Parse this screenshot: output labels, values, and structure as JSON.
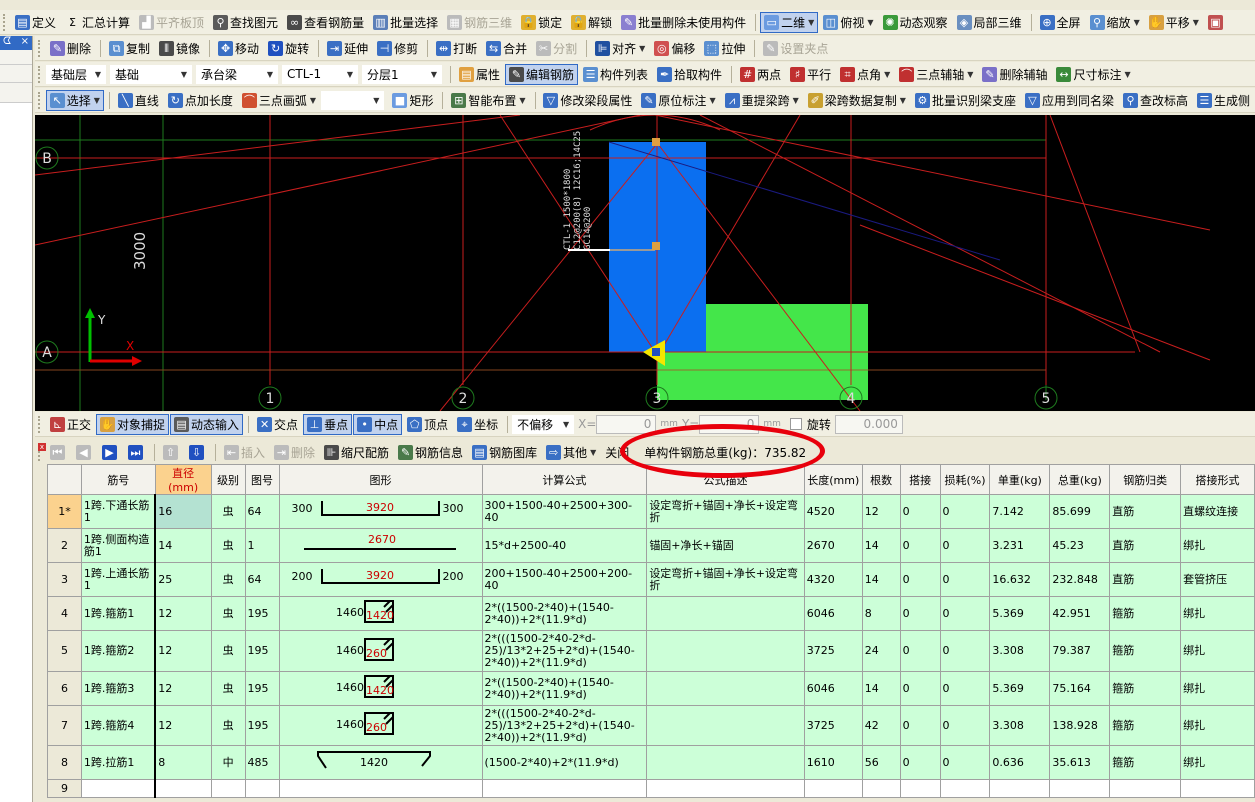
{
  "toolbar1": [
    {
      "icon": "define-icon",
      "glyph": "▤",
      "color": "#3a6fc4",
      "label": "定义"
    },
    {
      "icon": "sigma-icon",
      "glyph": "Σ",
      "color": "#f1efe2",
      "label": "汇总计算"
    },
    {
      "icon": "align-top-icon",
      "glyph": "▟",
      "color": "#bbb",
      "label": "平齐板顶",
      "disabled": true
    },
    {
      "icon": "binoculars-icon",
      "glyph": "⚲",
      "color": "#5a5a5a",
      "label": "查找图元"
    },
    {
      "icon": "view-rebar-icon",
      "glyph": "∞",
      "color": "#4a4a4a",
      "label": "查看钢筋量"
    },
    {
      "icon": "batch-select-icon",
      "glyph": "▥",
      "color": "#5b7fb8",
      "label": "批量选择"
    },
    {
      "icon": "rebar-3d-icon",
      "glyph": "▦",
      "color": "#bbb",
      "label": "钢筋三维",
      "disabled": true
    },
    {
      "icon": "lock-icon",
      "glyph": "🔒",
      "color": "#e0b030",
      "label": "锁定"
    },
    {
      "icon": "unlock-icon",
      "glyph": "🔓",
      "color": "#e0b030",
      "label": "解锁"
    },
    {
      "icon": "batch-delete-icon",
      "glyph": "✎",
      "color": "#8a7fd0",
      "label": "批量删除未使用构件"
    },
    {
      "sep": true
    },
    {
      "icon": "2d-icon",
      "glyph": "▭",
      "color": "#6b9be0",
      "label": "二维",
      "dropdown": true,
      "active": true
    },
    {
      "icon": "top-view-icon",
      "glyph": "◫",
      "color": "#5a8fd0",
      "label": "俯视",
      "dropdown": true
    },
    {
      "icon": "orbit-icon",
      "glyph": "✺",
      "color": "#3a9a3a",
      "label": "动态观察"
    },
    {
      "icon": "local-3d-icon",
      "glyph": "◈",
      "color": "#6a8fc0",
      "label": "局部三维"
    },
    {
      "sep": true
    },
    {
      "icon": "fullscreen-icon",
      "glyph": "⊕",
      "color": "#3a6fc4",
      "label": "全屏"
    },
    {
      "icon": "zoom-icon",
      "glyph": "⚲",
      "color": "#5a8fd0",
      "label": "缩放",
      "dropdown": true
    },
    {
      "icon": "pan-icon",
      "glyph": "✋",
      "color": "#d8a040",
      "label": "平移",
      "dropdown": true
    },
    {
      "icon": "screen-icon",
      "glyph": "▣",
      "color": "#c05050",
      "label": ""
    }
  ],
  "toolbar2": [
    {
      "icon": "eraser-icon",
      "glyph": "✎",
      "color": "#7a70c8",
      "label": "删除"
    },
    {
      "sep": true
    },
    {
      "icon": "copy-icon",
      "glyph": "⧉",
      "color": "#5a8fd0",
      "label": "复制"
    },
    {
      "icon": "mirror-icon",
      "glyph": "⫴",
      "color": "#4a4a4a",
      "label": "镜像"
    },
    {
      "sep": true
    },
    {
      "icon": "move-icon",
      "glyph": "✥",
      "color": "#3a6fc4",
      "label": "移动"
    },
    {
      "icon": "rotate-icon",
      "glyph": "↻",
      "color": "#2050c0",
      "label": "旋转"
    },
    {
      "sep": true
    },
    {
      "icon": "extend-icon",
      "glyph": "⇥",
      "color": "#3a6fc4",
      "label": "延伸"
    },
    {
      "icon": "trim-icon",
      "glyph": "⊣",
      "color": "#3a6fc4",
      "label": "修剪"
    },
    {
      "sep": true
    },
    {
      "icon": "break-icon",
      "glyph": "⇹",
      "color": "#3a6fc4",
      "label": "打断"
    },
    {
      "icon": "merge-icon",
      "glyph": "⇆",
      "color": "#3a6fc4",
      "label": "合并"
    },
    {
      "icon": "split-icon",
      "glyph": "✂",
      "color": "#bbb",
      "label": "分割",
      "disabled": true
    },
    {
      "sep": true
    },
    {
      "icon": "align-icon",
      "glyph": "⊫",
      "color": "#2050a0",
      "label": "对齐",
      "dropdown": true
    },
    {
      "icon": "offset-icon",
      "glyph": "◎",
      "color": "#d05050",
      "label": "偏移"
    },
    {
      "icon": "stretch-icon",
      "glyph": "⬚",
      "color": "#5a8fd0",
      "label": "拉伸"
    },
    {
      "sep": true
    },
    {
      "icon": "grip-point-icon",
      "glyph": "✎",
      "color": "#bbb",
      "label": "设置夹点",
      "disabled": true
    }
  ],
  "toolbar3_selects": [
    "基础层",
    "基础",
    "承台梁",
    "CTL-1",
    "分层1"
  ],
  "toolbar3": [
    {
      "icon": "properties-icon",
      "glyph": "▤",
      "color": "#e0a040",
      "label": "属性"
    },
    {
      "icon": "edit-rebar-icon",
      "glyph": "✎",
      "color": "#4a4a4a",
      "label": "编辑钢筋",
      "active": true
    },
    {
      "icon": "component-list-icon",
      "glyph": "☰",
      "color": "#5a8fd0",
      "label": "构件列表"
    },
    {
      "icon": "pick-component-icon",
      "glyph": "✒",
      "color": "#3a6fc4",
      "label": "拾取构件"
    },
    {
      "sep": true
    },
    {
      "icon": "two-point-icon",
      "glyph": "#",
      "color": "#c03030",
      "label": "两点"
    },
    {
      "icon": "parallel-icon",
      "glyph": "♯",
      "color": "#c03030",
      "label": "平行"
    },
    {
      "icon": "point-angle-icon",
      "glyph": "⌗",
      "color": "#c03030",
      "label": "点角",
      "dropdown": true
    },
    {
      "icon": "three-point-axis-icon",
      "glyph": "⌒",
      "color": "#c03030",
      "label": "三点辅轴",
      "dropdown": true
    },
    {
      "icon": "delete-axis-icon",
      "glyph": "✎",
      "color": "#7a70c8",
      "label": "删除辅轴"
    },
    {
      "icon": "dimension-icon",
      "glyph": "↔",
      "color": "#3a8a3a",
      "label": "尺寸标注",
      "dropdown": true
    }
  ],
  "toolbar4": [
    {
      "icon": "select-cursor-icon",
      "glyph": "↖",
      "color": "#5a8fd0",
      "label": "选择",
      "dropdown": true,
      "active": true
    },
    {
      "sep": true
    },
    {
      "icon": "line-icon",
      "glyph": "╲",
      "color": "#3a6fc4",
      "label": "直线"
    },
    {
      "icon": "point-length-icon",
      "glyph": "↻",
      "color": "#3a6fc4",
      "label": "点加长度"
    },
    {
      "icon": "arc-icon",
      "glyph": "⌒",
      "color": "#d05030",
      "label": "三点画弧",
      "dropdown": true
    },
    {
      "select": ""
    },
    {
      "icon": "rectangle-icon",
      "glyph": "■",
      "color": "#6b9be0",
      "label": "矩形"
    },
    {
      "sep": true
    },
    {
      "icon": "smart-layout-icon",
      "glyph": "⊞",
      "color": "#4a7a4a",
      "label": "智能布置",
      "dropdown": true
    },
    {
      "sep": true
    },
    {
      "icon": "modify-span-icon",
      "glyph": "▽",
      "color": "#3a6fc4",
      "label": "修改梁段属性"
    },
    {
      "icon": "in-situ-annotation-icon",
      "glyph": "✎",
      "color": "#3a6fc4",
      "label": "原位标注",
      "dropdown": true
    },
    {
      "icon": "re-extract-span-icon",
      "glyph": "⩘",
      "color": "#3a6fc4",
      "label": "重提梁跨",
      "dropdown": true
    },
    {
      "icon": "copy-span-data-icon",
      "glyph": "✐",
      "color": "#c8a030",
      "label": "梁跨数据复制",
      "dropdown": true
    },
    {
      "icon": "identify-support-icon",
      "glyph": "⚙",
      "color": "#3a6fc4",
      "label": "批量识别梁支座"
    },
    {
      "icon": "apply-same-name-icon",
      "glyph": "▽",
      "color": "#3a6fc4",
      "label": "应用到同名梁"
    },
    {
      "icon": "modify-elevation-icon",
      "glyph": "⚲",
      "color": "#3a6fc4",
      "label": "查改标高"
    },
    {
      "icon": "generate-side-icon",
      "glyph": "☰",
      "color": "#3a6fc4",
      "label": "生成侧"
    }
  ],
  "left_panel": {
    "pin": "ᗧ",
    "close": "×"
  },
  "canvas": {
    "axis_rows": [
      "B",
      "A"
    ],
    "axis_cols": [
      "1",
      "2",
      "3",
      "4",
      "5"
    ],
    "dimension": "3000",
    "beam_label": [
      "CTL-1 1500*1800",
      "C12@200(8) 12C16;14C25",
      "GC14@200"
    ],
    "ucs_x": "X",
    "ucs_y": "Y",
    "colors": {
      "background": "#000000",
      "axis": "#c81e1e",
      "grid_green": "#1e7a1e",
      "beam": "#0b6ff0",
      "cap": "#44e64a"
    }
  },
  "snapbar": {
    "items": [
      {
        "icon": "ortho-icon",
        "glyph": "⊾",
        "color": "#c04040",
        "label": "正交"
      },
      {
        "icon": "object-snap-icon",
        "glyph": "✋",
        "color": "#d8a040",
        "label": "对象捕捉",
        "active": true
      },
      {
        "icon": "dynamic-input-icon",
        "glyph": "▤",
        "color": "#5a5a5a",
        "label": "动态输入",
        "active": true
      },
      {
        "sep": true
      },
      {
        "icon": "intersection-icon",
        "glyph": "✕",
        "color": "#3a6fc4",
        "label": "交点"
      },
      {
        "icon": "perpendicular-icon",
        "glyph": "⊥",
        "color": "#3a6fc4",
        "label": "垂点",
        "active": true
      },
      {
        "icon": "midpoint-icon",
        "glyph": "•",
        "color": "#3a6fc4",
        "label": "中点",
        "active": true
      },
      {
        "icon": "vertex-icon",
        "glyph": "⬠",
        "color": "#3a6fc4",
        "label": "顶点"
      },
      {
        "icon": "coordinate-icon",
        "glyph": "⌖",
        "color": "#3a6fc4",
        "label": "坐标"
      }
    ],
    "offset_select": "不偏移",
    "x_label": "X=",
    "x_value": "0",
    "y_label": "Y=",
    "y_value": "0",
    "unit": "mm",
    "rotate_label": "旋转",
    "rotate_value": "0.000"
  },
  "table_toolbar": {
    "items": [
      {
        "icon": "first-icon",
        "glyph": "⏮",
        "color": "#bbb",
        "label": "",
        "disabled": true
      },
      {
        "icon": "prev-icon",
        "glyph": "◀",
        "color": "#bbb",
        "label": "",
        "disabled": true
      },
      {
        "icon": "next-icon",
        "glyph": "▶",
        "color": "#2050c0",
        "label": ""
      },
      {
        "icon": "last-icon",
        "glyph": "⏭",
        "color": "#2050c0",
        "label": ""
      },
      {
        "sep": true
      },
      {
        "icon": "move-up-icon",
        "glyph": "⇧",
        "color": "#bbb",
        "label": "",
        "disabled": true
      },
      {
        "icon": "move-down-icon",
        "glyph": "⇩",
        "color": "#2050c0",
        "label": ""
      },
      {
        "sep": true
      },
      {
        "icon": "insert-icon",
        "glyph": "⇤",
        "color": "#bbb",
        "label": "插入",
        "disabled": true
      },
      {
        "icon": "delete-row-icon",
        "glyph": "⇥",
        "color": "#bbb",
        "label": "删除",
        "disabled": true
      },
      {
        "icon": "scale-rebar-icon",
        "glyph": "⊪",
        "color": "#4a4a4a",
        "label": "缩尺配筋"
      },
      {
        "icon": "rebar-info-icon",
        "glyph": "✎",
        "color": "#4a7a4a",
        "label": "钢筋信息"
      },
      {
        "icon": "rebar-library-icon",
        "glyph": "▤",
        "color": "#3a6fc4",
        "label": "钢筋图库"
      },
      {
        "icon": "other-icon",
        "glyph": "⇨",
        "color": "#3a6fc4",
        "label": "其他",
        "dropdown": true
      },
      {
        "label": "关闭"
      }
    ],
    "total_weight_label": "单构件钢筋总重(kg)：",
    "total_weight": "735.82"
  },
  "table": {
    "headers": [
      "",
      "筋号",
      "直径(mm)",
      "级别",
      "图号",
      "图形",
      "计算公式",
      "公式描述",
      "长度(mm)",
      "根数",
      "搭接",
      "损耗(%)",
      "单重(kg)",
      "总重(kg)",
      "钢筋归类",
      "搭接形式"
    ],
    "rows": [
      {
        "num": "1*",
        "name": "1跨.下通长筋1",
        "dia": "16",
        "grade": "虫",
        "fig": "64",
        "shape": {
          "type": "bent",
          "left": "300",
          "mid": "3920",
          "right": "300"
        },
        "formula": "300+1500-40+2500+300-40",
        "desc": "设定弯折+锚固+净长+设定弯折",
        "length": "4520",
        "count": "12",
        "lap": "0",
        "loss": "0",
        "unit_wt": "7.142",
        "total_wt": "85.699",
        "category": "直筋",
        "lap_type": "直螺纹连接"
      },
      {
        "num": "2",
        "name": "1跨.侧面构造筋1",
        "dia": "14",
        "grade": "虫",
        "fig": "1",
        "shape": {
          "type": "straight",
          "mid": "2670"
        },
        "formula": "15*d+2500-40",
        "desc": "锚固+净长+锚固",
        "length": "2670",
        "count": "14",
        "lap": "0",
        "loss": "0",
        "unit_wt": "3.231",
        "total_wt": "45.23",
        "category": "直筋",
        "lap_type": "绑扎"
      },
      {
        "num": "3",
        "name": "1跨.上通长筋1",
        "dia": "25",
        "grade": "虫",
        "fig": "64",
        "shape": {
          "type": "bent",
          "left": "200",
          "mid": "3920",
          "right": "200"
        },
        "formula": "200+1500-40+2500+200-40",
        "desc": "设定弯折+锚固+净长+设定弯折",
        "length": "4320",
        "count": "14",
        "lap": "0",
        "loss": "0",
        "unit_wt": "16.632",
        "total_wt": "232.848",
        "category": "直筋",
        "lap_type": "套管挤压"
      },
      {
        "num": "4",
        "name": "1跨.箍筋1",
        "dia": "12",
        "grade": "虫",
        "fig": "195",
        "shape": {
          "type": "stirrup",
          "left": "1460",
          "mid": "1420"
        },
        "formula": "2*((1500-2*40)+(1540-2*40))+2*(11.9*d)",
        "desc": "",
        "length": "6046",
        "count": "8",
        "lap": "0",
        "loss": "0",
        "unit_wt": "5.369",
        "total_wt": "42.951",
        "category": "箍筋",
        "lap_type": "绑扎"
      },
      {
        "num": "5",
        "name": "1跨.箍筋2",
        "dia": "12",
        "grade": "虫",
        "fig": "195",
        "shape": {
          "type": "stirrup",
          "left": "1460",
          "mid": "260"
        },
        "formula": "2*(((1500-2*40-2*d-25)/13*2+25+2*d)+(1540-2*40))+2*(11.9*d)",
        "desc": "",
        "length": "3725",
        "count": "24",
        "lap": "0",
        "loss": "0",
        "unit_wt": "3.308",
        "total_wt": "79.387",
        "category": "箍筋",
        "lap_type": "绑扎"
      },
      {
        "num": "6",
        "name": "1跨.箍筋3",
        "dia": "12",
        "grade": "虫",
        "fig": "195",
        "shape": {
          "type": "stirrup",
          "left": "1460",
          "mid": "1420"
        },
        "formula": "2*((1500-2*40)+(1540-2*40))+2*(11.9*d)",
        "desc": "",
        "length": "6046",
        "count": "14",
        "lap": "0",
        "loss": "0",
        "unit_wt": "5.369",
        "total_wt": "75.164",
        "category": "箍筋",
        "lap_type": "绑扎"
      },
      {
        "num": "7",
        "name": "1跨.箍筋4",
        "dia": "12",
        "grade": "虫",
        "fig": "195",
        "shape": {
          "type": "stirrup",
          "left": "1460",
          "mid": "260"
        },
        "formula": "2*(((1500-2*40-2*d-25)/13*2+25+2*d)+(1540-2*40))+2*(11.9*d)",
        "desc": "",
        "length": "3725",
        "count": "42",
        "lap": "0",
        "loss": "0",
        "unit_wt": "3.308",
        "total_wt": "138.928",
        "category": "箍筋",
        "lap_type": "绑扎"
      },
      {
        "num": "8",
        "name": "1跨.拉筋1",
        "dia": "8",
        "grade": "中",
        "fig": "485",
        "shape": {
          "type": "tie",
          "mid": "1420"
        },
        "formula": "(1500-2*40)+2*(11.9*d)",
        "desc": "",
        "length": "1610",
        "count": "56",
        "lap": "0",
        "loss": "0",
        "unit_wt": "0.636",
        "total_wt": "35.613",
        "category": "箍筋",
        "lap_type": "绑扎"
      },
      {
        "num": "9",
        "name": "",
        "dia": "",
        "grade": "",
        "fig": "",
        "shape": {
          "type": "none"
        },
        "formula": "",
        "desc": "",
        "length": "",
        "count": "",
        "lap": "",
        "loss": "",
        "unit_wt": "",
        "total_wt": "",
        "category": "",
        "lap_type": ""
      }
    ]
  },
  "annotation_color": "#e8000c"
}
